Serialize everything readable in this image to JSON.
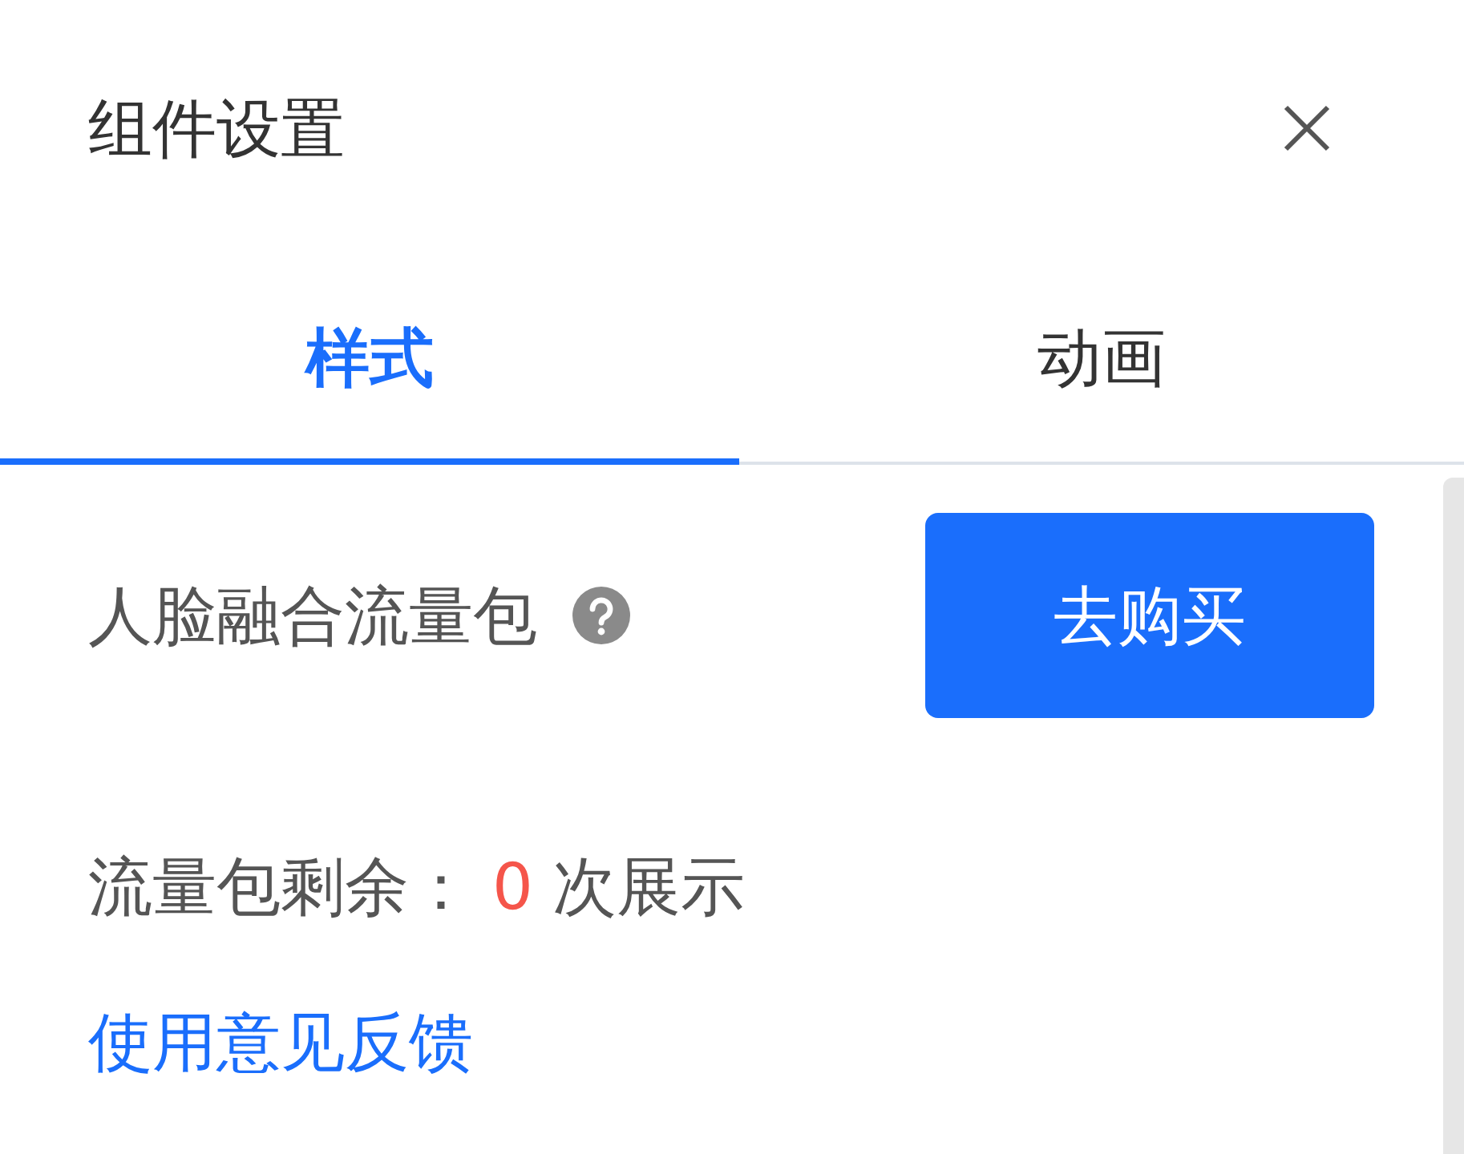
{
  "panel": {
    "title": "组件设置"
  },
  "tabs": [
    {
      "label": "样式",
      "selected": true
    },
    {
      "label": "动画",
      "selected": false
    }
  ],
  "package": {
    "label": "人脸融合流量包",
    "button": "去购买",
    "remaining_label": "流量包剩余：",
    "remaining_count": "0",
    "remaining_unit": "次展示"
  },
  "feedback_link": "使用意见反馈"
}
